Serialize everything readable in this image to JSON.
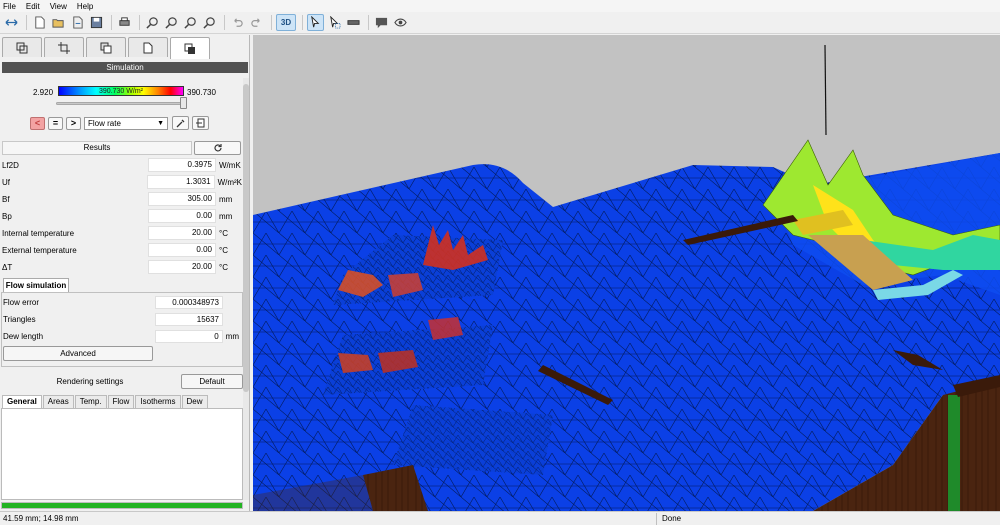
{
  "menu": [
    "File",
    "Edit",
    "View",
    "Help"
  ],
  "toolbar": {
    "mode_3d_label": "3D"
  },
  "simulation": {
    "header": "Simulation",
    "legend": {
      "min": "2.920",
      "max": "390.730",
      "bar_label": "390.730 W/m²",
      "slider_position": 0.98
    },
    "nav": {
      "prev": "<",
      "equal": "=",
      "next": ">"
    },
    "quantity_select": "Flow rate"
  },
  "results": {
    "header": "Results",
    "rows": [
      {
        "label": "Lf2D",
        "value": "0.3975",
        "unit": "W/mK"
      },
      {
        "label": "Uf",
        "value": "1.3031",
        "unit": "W/m²K"
      },
      {
        "label": "Bf",
        "value": "305.00",
        "unit": "mm"
      },
      {
        "label": "Bp",
        "value": "0.00",
        "unit": "mm"
      },
      {
        "label": "Internal temperature",
        "value": "20.00",
        "unit": "°C"
      },
      {
        "label": "External temperature",
        "value": "0.00",
        "unit": "°C"
      },
      {
        "label": "ΔT",
        "value": "20.00",
        "unit": "°C"
      }
    ]
  },
  "flow_simulation": {
    "tab": "Flow simulation",
    "rows": [
      {
        "label": "Flow error",
        "value": "0.000348973",
        "unit": ""
      },
      {
        "label": "Triangles",
        "value": "15637",
        "unit": ""
      },
      {
        "label": "Dew length",
        "value": "0",
        "unit": "mm"
      }
    ],
    "advanced_button": "Advanced"
  },
  "rendering": {
    "header": "Rendering settings",
    "default_button": "Default",
    "tabs": [
      "General",
      "Areas",
      "Temp.",
      "Flow",
      "Isotherms",
      "Dew"
    ]
  },
  "progress_fraction": 1.0,
  "status": {
    "coords": "41.59 mm; 14.98 mm",
    "message": "Done"
  },
  "colors": {
    "mesh_blue": "#0b40e6",
    "wall_brown": "#4a2410",
    "viewport_bg": "#c2c2c2",
    "progress_green": "#22b322"
  }
}
